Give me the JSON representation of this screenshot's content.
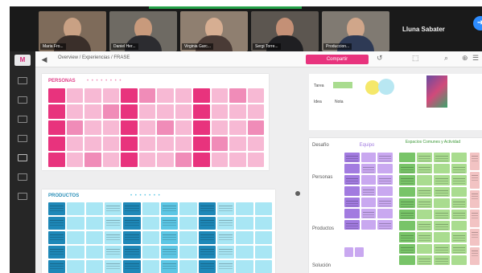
{
  "meeting": {
    "participants": [
      {
        "name": "Maria Fro..."
      },
      {
        "name": "Daniel Her..."
      },
      {
        "name": "Virginia Garc..."
      },
      {
        "name": "Sergi Torre..."
      },
      {
        "name": "Produccion..."
      }
    ],
    "more_label": "Lluna Sabater",
    "top_button_icon": "arrow-icon",
    "colors": {
      "bar": "#1a1a1a",
      "active_speaker": "#24a148",
      "tiles": [
        "#7e6b5a",
        "#6e6a63",
        "#8f7f70",
        "#5c5650",
        "#807a72"
      ]
    }
  },
  "app": {
    "logo_text": "M",
    "breadcrumb": "Overview / Experiencias / FRASE",
    "share_label": "Compartir",
    "accent_color": "#e8337d",
    "rail_icons": [
      "frame-icon",
      "grid-icon",
      "sticky-icon",
      "shape-icon",
      "pen-icon",
      "comment-icon",
      "upload-icon"
    ]
  },
  "board": {
    "pink_sheet": {
      "title": "PERSONAS",
      "subtitle": "• • • • • • • •",
      "colors": {
        "dark": "#e8337d",
        "light": "#f7b9d4",
        "mid": "#f08cb8",
        "title": "#e0418a"
      }
    },
    "blue_sheet": {
      "title": "PRODUCTOS",
      "subtitle": "• • • • • • •",
      "colors": {
        "dark": "#1e88b8",
        "light": "#a8e6f4",
        "mid": "#5cc6e4",
        "title": "#2a8fb8"
      }
    },
    "right_header": {
      "chip_a": "Tarea",
      "chip_b": "Idea",
      "chip_c": "Nota"
    },
    "matrix": {
      "row_labels": [
        "Desafío",
        "Personas",
        "Productos",
        "Solución"
      ],
      "col_heads": [
        "Equipo",
        "Espacios Comunes y Actividad"
      ],
      "colors": {
        "purple": "#c9a8f0",
        "purple_dark": "#a27be0",
        "green": "#a9dc8f",
        "green_dark": "#78c468",
        "red_note": "#f2c3c3"
      }
    }
  }
}
